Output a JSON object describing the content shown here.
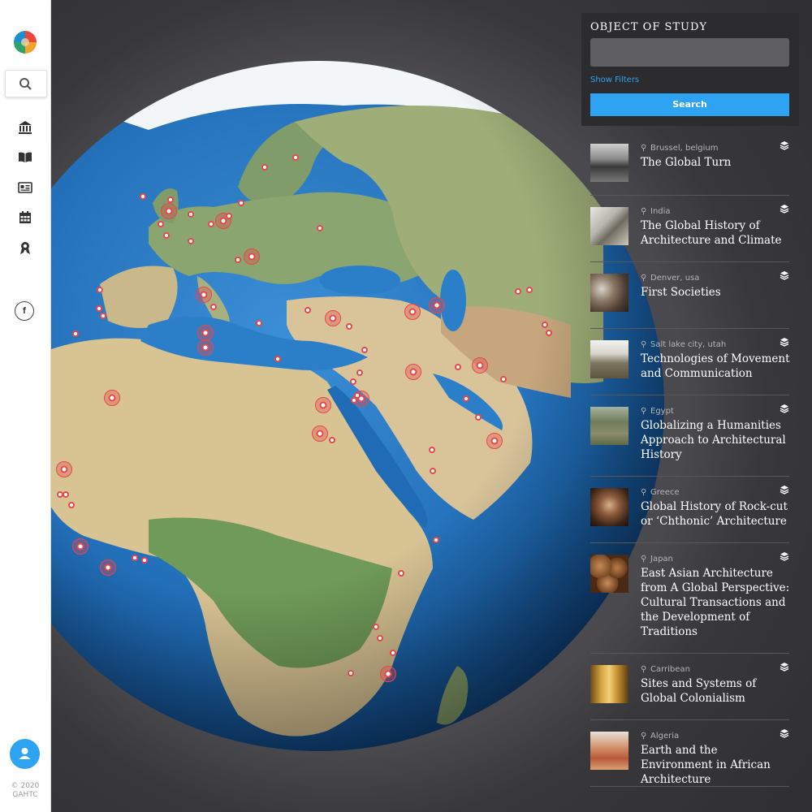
{
  "sidebar": {
    "icons": [
      "logo",
      "search-icon",
      "institution-icon",
      "book-icon",
      "id-card-icon",
      "calendar-icon",
      "award-icon",
      "facebook-icon",
      "user-icon"
    ],
    "facebook_label": "f",
    "copyright_line1": "© 2020",
    "copyright_line2": "GAHTC"
  },
  "search_panel": {
    "title": "OBJECT OF STUDY",
    "input_value": "",
    "input_placeholder": "",
    "filters_label": "Show Filters",
    "search_label": "Search"
  },
  "colors": {
    "accent": "#2ea3f2",
    "panel": "#2c2c2e",
    "marker": "#e8474b"
  },
  "results": [
    {
      "location": "Brussel, belgium",
      "title": "The Global Turn",
      "thumb": "grayscale-crowd"
    },
    {
      "location": "India",
      "title": "The Global History of Architecture and Climate",
      "thumb": "modern-interior"
    },
    {
      "location": "Denver, usa",
      "title": "First Societies",
      "thumb": "ancient-crowd"
    },
    {
      "location": "Salt lake city, utah",
      "title": "Technologies of Movement and Communication",
      "thumb": "temple-landscape"
    },
    {
      "location": "Egypt",
      "title": "Globalizing a Humanities Approach to Architectural History",
      "thumb": "aerial-village"
    },
    {
      "location": "Greece",
      "title": "Global History of Rock-cut or ‘Chthonic’ Architecture",
      "thumb": "rock-cave"
    },
    {
      "location": "Japan",
      "title": "East Asian Architecture from A Global Perspective: Cultural Transactions and the Development of Traditions",
      "thumb": "clay-domes"
    },
    {
      "location": "Carribean",
      "title": "Sites and Systems of Global Colonialism",
      "thumb": "golden-cathedral"
    },
    {
      "location": "Algeria",
      "title": "Earth and the Environment in African Architecture",
      "thumb": "adobe-arch"
    }
  ]
}
